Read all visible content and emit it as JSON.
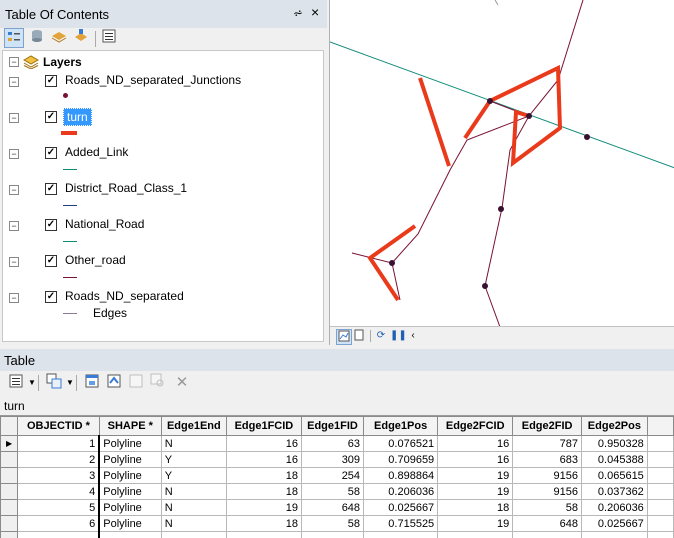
{
  "toc": {
    "title": "Table Of Contents",
    "pin": "⩫",
    "close": "×",
    "group_label": "Layers",
    "layers": [
      {
        "name": "Roads_ND_separated_Junctions",
        "symbol": "dot",
        "color": "#7a1033"
      },
      {
        "name": "turn",
        "symbol": "thick-line",
        "color": "#ea3a1c",
        "selected": true
      },
      {
        "name": "Added_Link",
        "symbol": "line",
        "color": "#0e8a7a"
      },
      {
        "name": "District_Road_Class_1",
        "symbol": "line",
        "color": "#203c8c"
      },
      {
        "name": "National_Road",
        "symbol": "line",
        "color": "#0e8a7a"
      },
      {
        "name": "Other_road",
        "symbol": "line",
        "color": "#7a1033"
      },
      {
        "name": "Roads_ND_separated",
        "symbol": "line",
        "color": "#8a7a9a",
        "sublabel": "Edges"
      }
    ]
  },
  "map": {
    "colors": {
      "turn": "#ea3a1c",
      "road": "#7a1033",
      "link": "#0e8a7a"
    }
  },
  "table_panel": {
    "title": "Table",
    "table_name": "turn",
    "columns": [
      "OBJECTID *",
      "SHAPE *",
      "Edge1End",
      "Edge1FCID",
      "Edge1FID",
      "Edge1Pos",
      "Edge2FCID",
      "Edge2FID",
      "Edge2Pos"
    ],
    "rows": [
      [
        "1",
        "Polyline",
        "N",
        "16",
        "63",
        "0.076521",
        "16",
        "787",
        "0.950328"
      ],
      [
        "2",
        "Polyline",
        "Y",
        "16",
        "309",
        "0.709659",
        "16",
        "683",
        "0.045388"
      ],
      [
        "3",
        "Polyline",
        "Y",
        "18",
        "254",
        "0.898864",
        "19",
        "9156",
        "0.065615"
      ],
      [
        "4",
        "Polyline",
        "N",
        "18",
        "58",
        "0.206036",
        "19",
        "9156",
        "0.037362"
      ],
      [
        "5",
        "Polyline",
        "N",
        "19",
        "648",
        "0.025667",
        "18",
        "58",
        "0.206036"
      ],
      [
        "6",
        "Polyline",
        "N",
        "18",
        "58",
        "0.715525",
        "19",
        "648",
        "0.025667"
      ]
    ]
  }
}
